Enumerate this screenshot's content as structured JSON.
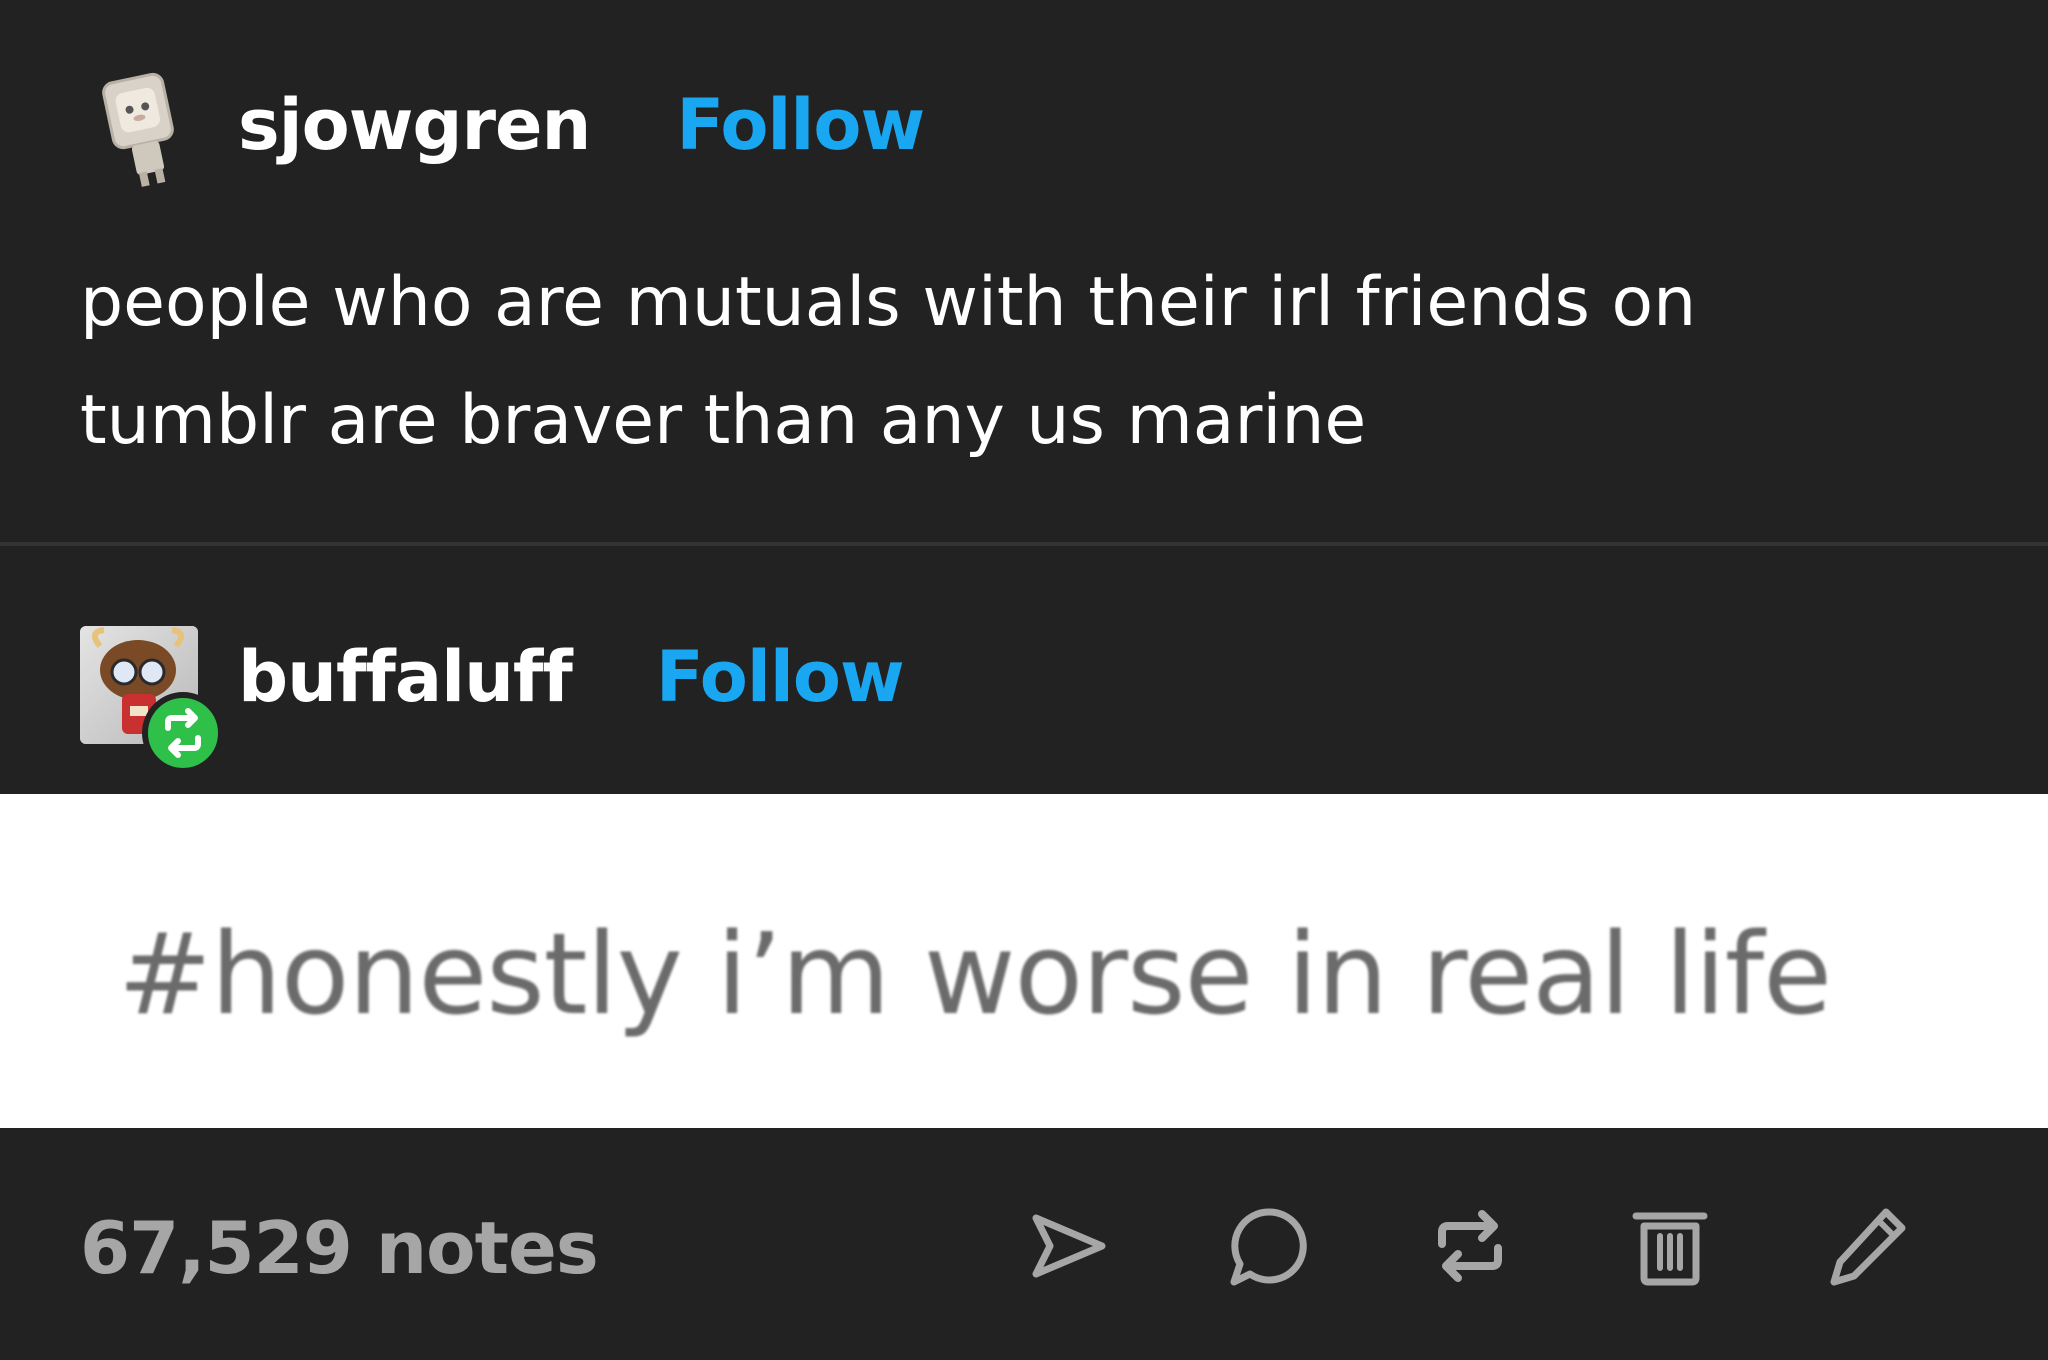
{
  "posts": [
    {
      "username": "sjowgren",
      "follow_label": "Follow",
      "body": "people who are mutuals with their irl friends on tumblr are braver than any us marine"
    },
    {
      "username": "buffaluff",
      "follow_label": "Follow",
      "reblog_badge_icon": "reblog-icon",
      "tag": "#honestly i’m worse in real life"
    }
  ],
  "footer": {
    "notes": "67,529 notes",
    "actions": [
      "share-icon",
      "reply-icon",
      "reblog-icon",
      "delete-icon",
      "edit-icon"
    ]
  },
  "colors": {
    "background": "#222222",
    "follow": "#1aa7f2",
    "reblog_badge": "#2fc04a",
    "tag_band": "#ffffff",
    "notes": "#a6a6a6"
  }
}
